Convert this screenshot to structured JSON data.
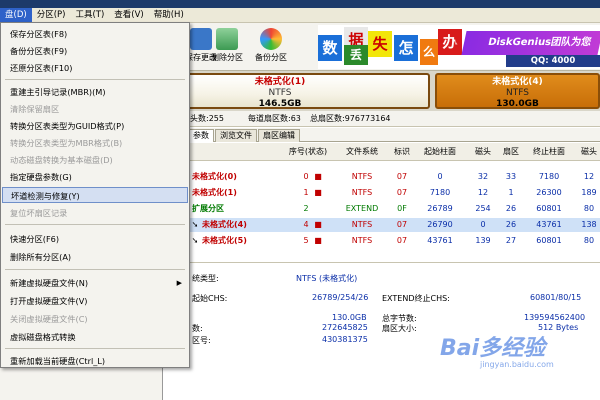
{
  "menubar": {
    "items": [
      "盘(D)",
      "分区(P)",
      "工具(T)",
      "查看(V)",
      "帮助(H)"
    ]
  },
  "toolbar": {
    "items": [
      "保存更改",
      "删除分区",
      "备份分区"
    ]
  },
  "banner": {
    "tiles": [
      "数",
      "据",
      "丢",
      "失",
      "怎",
      "么",
      "办",
      "!"
    ],
    "promo": "DiskGenius团队为您",
    "qq": "QQ: 4000"
  },
  "disk": {
    "part_a": {
      "label": "未格式化(1)",
      "fs": "NTFS",
      "size": "146.5GB"
    },
    "part_b": {
      "label": "未格式化(4)",
      "fs": "NTFS",
      "size": "130.0GB"
    }
  },
  "info": {
    "heads": "头数:255",
    "sectors_per_track": "每道扇区数:63",
    "total_sectors": "总扇区数:976773164"
  },
  "tabs": [
    "参数",
    "浏览文件",
    "扇区编辑"
  ],
  "table": {
    "headers": [
      "序号(状态)",
      "文件系统",
      "标识",
      "起始柱面",
      "磁头",
      "扇区",
      "终止柱面",
      "磁头"
    ],
    "rows": [
      {
        "name": "未格式化(0)",
        "idx": "0",
        "fs": "NTFS",
        "id": "07",
        "start": "0",
        "head": "32",
        "sector": "33",
        "end": "7180",
        "ehead": "12"
      },
      {
        "name": "未格式化(1)",
        "idx": "1",
        "fs": "NTFS",
        "id": "07",
        "start": "7180",
        "head": "12",
        "sector": "1",
        "end": "26300",
        "ehead": "189"
      },
      {
        "name": "扩展分区",
        "idx": "2",
        "fs": "EXTEND",
        "id": "0F",
        "start": "26789",
        "head": "254",
        "sector": "26",
        "end": "60801",
        "ehead": "80"
      },
      {
        "name": "未格式化(4)",
        "idx": "4",
        "fs": "NTFS",
        "id": "07",
        "start": "26790",
        "head": "0",
        "sector": "26",
        "end": "43761",
        "ehead": "138"
      },
      {
        "name": "未格式化(5)",
        "idx": "5",
        "fs": "NTFS",
        "id": "07",
        "start": "43761",
        "head": "139",
        "sector": "27",
        "end": "60801",
        "ehead": "80"
      }
    ]
  },
  "details": {
    "fs_type_label": "统类型:",
    "fs_type_value": "NTFS (未格式化)",
    "start_chs_label": "起始CHS:",
    "start_chs_value": "26789/254/26",
    "extend_end_label": "EXTEND终止CHS:",
    "extend_end_value": "60801/80/15",
    "size_value": "130.0GB",
    "total_bytes_label": "总字节数:",
    "total_bytes_value": "139594562400",
    "count_label": "数:",
    "count_value": "272645825",
    "sector_size_label": "扇区大小:",
    "sector_size_value": "512 Bytes",
    "sector_no_label": "区号:",
    "sector_no_value": "430381375"
  },
  "dropdown": {
    "items": [
      {
        "label": "保存分区表(F8)",
        "disabled": false
      },
      {
        "label": "备份分区表(F9)",
        "disabled": false
      },
      {
        "label": "还原分区表(F10)",
        "disabled": false
      },
      {
        "label": "重建主引导记录(MBR)(M)",
        "disabled": false
      },
      {
        "label": "清除保留扇区",
        "disabled": true
      },
      {
        "label": "转换分区表类型为GUID格式(P)",
        "disabled": false
      },
      {
        "label": "转换分区表类型为MBR格式(B)",
        "disabled": true
      },
      {
        "label": "动态磁盘转换为基本磁盘(D)",
        "disabled": true
      },
      {
        "label": "指定硬盘参数(G)",
        "disabled": false
      },
      {
        "label": "坏道检测与修复(Y)",
        "disabled": false
      },
      {
        "label": "复位坏扇区记录",
        "disabled": true
      },
      {
        "label": "快速分区(F6)",
        "disabled": false
      },
      {
        "label": "删除所有分区(A)",
        "disabled": false
      },
      {
        "label": "新建虚拟硬盘文件(N)",
        "disabled": false
      },
      {
        "label": "打开虚拟硬盘文件(V)",
        "disabled": false
      },
      {
        "label": "关闭虚拟硬盘文件(C)",
        "disabled": true
      },
      {
        "label": "虚拟磁盘格式转换",
        "disabled": false
      },
      {
        "label": "重新加载当前硬盘(Ctrl_L)",
        "disabled": false
      }
    ]
  },
  "watermark": {
    "main": "Bai多经验",
    "sub": "jingyan.baidu.com"
  },
  "colors": {
    "menu_highlight": "#2f62c9",
    "partition_label": "#c60000",
    "banner_promo": "#8a2be2"
  }
}
